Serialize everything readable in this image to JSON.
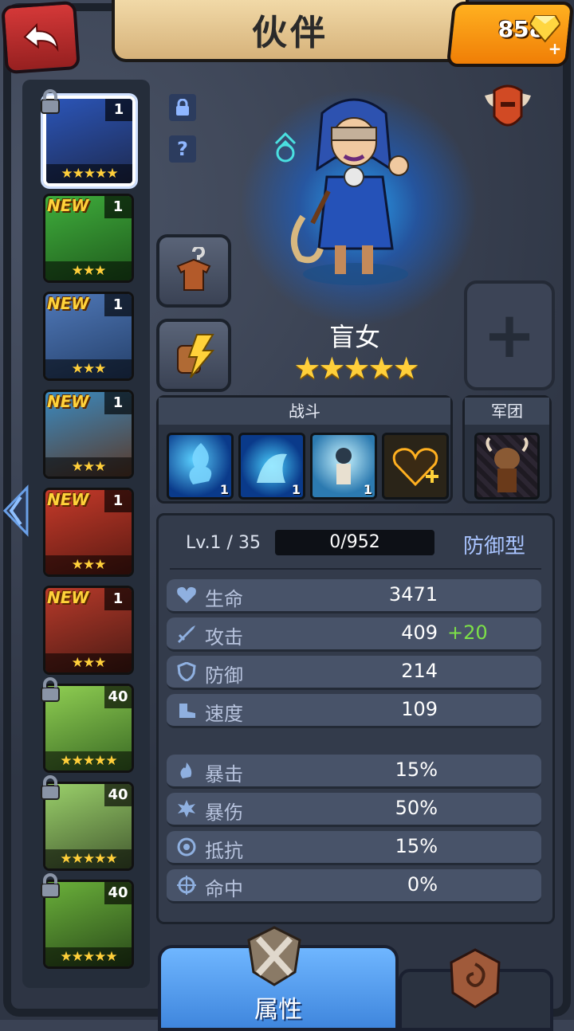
{
  "header": {
    "title": "伙伴",
    "gems": "858"
  },
  "heroes": [
    {
      "level": "1",
      "stars": "★★★★★",
      "new": "",
      "locked": true,
      "selected": true,
      "colors": [
        "#2b55b8",
        "#1e2a50"
      ]
    },
    {
      "level": "1",
      "stars": "★★★",
      "new": "NEW",
      "locked": false,
      "selected": false,
      "colors": [
        "#3fae3c",
        "#1f5a1c"
      ]
    },
    {
      "level": "1",
      "stars": "★★★",
      "new": "NEW",
      "locked": false,
      "selected": false,
      "colors": [
        "#4f78b8",
        "#25406a"
      ]
    },
    {
      "level": "1",
      "stars": "★★★",
      "new": "NEW",
      "locked": false,
      "selected": false,
      "colors": [
        "#3a8ac0",
        "#5a3a2a"
      ]
    },
    {
      "level": "1",
      "stars": "★★★",
      "new": "NEW",
      "locked": false,
      "selected": false,
      "colors": [
        "#c63a2a",
        "#5a1a12"
      ]
    },
    {
      "level": "1",
      "stars": "★★★",
      "new": "NEW",
      "locked": false,
      "selected": false,
      "colors": [
        "#b83a2a",
        "#4a1a14"
      ]
    },
    {
      "level": "40",
      "stars": "★★★★★",
      "new": "",
      "locked": true,
      "selected": false,
      "colors": [
        "#8fce52",
        "#3a6a24"
      ]
    },
    {
      "level": "40",
      "stars": "★★★★★",
      "new": "",
      "locked": true,
      "selected": false,
      "colors": [
        "#9ad06a",
        "#445a30"
      ]
    },
    {
      "level": "40",
      "stars": "★★★★★",
      "new": "",
      "locked": true,
      "selected": false,
      "colors": [
        "#6ab03a",
        "#2a4a1a"
      ]
    }
  ],
  "hero": {
    "name": "盲女",
    "stars": "★★★★★"
  },
  "skills": {
    "battle_label": "战斗",
    "legion_label": "军团",
    "levels": [
      "1",
      "1",
      "1"
    ]
  },
  "stats": {
    "level": "Lv.1 / 35",
    "exp": "0/952",
    "exp_fraction": 0,
    "role": "防御型",
    "rows": [
      {
        "label": "生命",
        "value": "3471",
        "bonus": ""
      },
      {
        "label": "攻击",
        "value": "409",
        "bonus": "+20"
      },
      {
        "label": "防御",
        "value": "214",
        "bonus": ""
      },
      {
        "label": "速度",
        "value": "109",
        "bonus": ""
      },
      {
        "label": "暴击",
        "value": "15%",
        "bonus": ""
      },
      {
        "label": "暴伤",
        "value": "50%",
        "bonus": ""
      },
      {
        "label": "抵抗",
        "value": "15%",
        "bonus": ""
      },
      {
        "label": "命中",
        "value": "0%",
        "bonus": ""
      }
    ]
  },
  "tabs": {
    "attributes": "属性"
  }
}
